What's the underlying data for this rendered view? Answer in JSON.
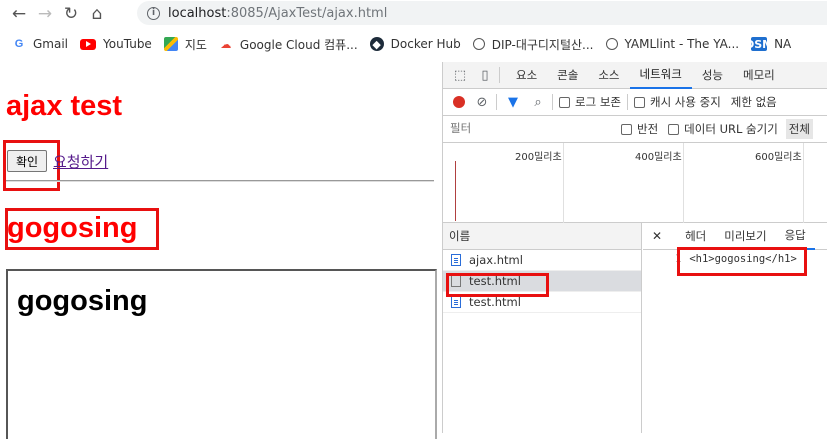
{
  "browser": {
    "url_host": "localhost",
    "url_rest": ":8085/AjaxTest/ajax.html",
    "bookmarks": [
      {
        "label": "Gmail",
        "icon": "google-icon"
      },
      {
        "label": "YouTube",
        "icon": "youtube-icon"
      },
      {
        "label": "지도",
        "icon": "maps-icon"
      },
      {
        "label": "Google Cloud 컴퓨...",
        "icon": "cloud-icon"
      },
      {
        "label": "Docker Hub",
        "icon": "docker-icon"
      },
      {
        "label": "DIP-대구디지털산...",
        "icon": "globe-icon"
      },
      {
        "label": "YAMLlint - The YA...",
        "icon": "globe-icon"
      },
      {
        "label": "NA",
        "icon": "dsm-icon"
      }
    ]
  },
  "page": {
    "title": "ajax test",
    "confirm_button": "확인",
    "request_link": "요청하기",
    "heading": "gogosing",
    "iframe_heading": "gogosing"
  },
  "devtools": {
    "tabs": [
      "요소",
      "콘솔",
      "소스",
      "네트워크",
      "성능",
      "메모리"
    ],
    "active_tab": "네트워크",
    "toolbar": {
      "preserve_log": "로그 보존",
      "disable_cache": "캐시 사용 중지",
      "throttle": "제한 없음"
    },
    "filter": {
      "placeholder": "필터",
      "invert": "반전",
      "hide_data_urls": "데이터 URL 숨기기",
      "all": "전체"
    },
    "timeline_marks": [
      "200밀리초",
      "400밀리초",
      "600밀리초"
    ],
    "names_header": "이름",
    "requests": [
      {
        "name": "ajax.html",
        "selected": false
      },
      {
        "name": "test.html",
        "selected": true
      },
      {
        "name": "test.html",
        "selected": false
      }
    ],
    "detail_tabs": [
      "헤더",
      "미리보기",
      "응답"
    ],
    "active_detail_tab": "응답",
    "response_line_number": "1",
    "response_text": "<h1>gogosing</h1>"
  }
}
